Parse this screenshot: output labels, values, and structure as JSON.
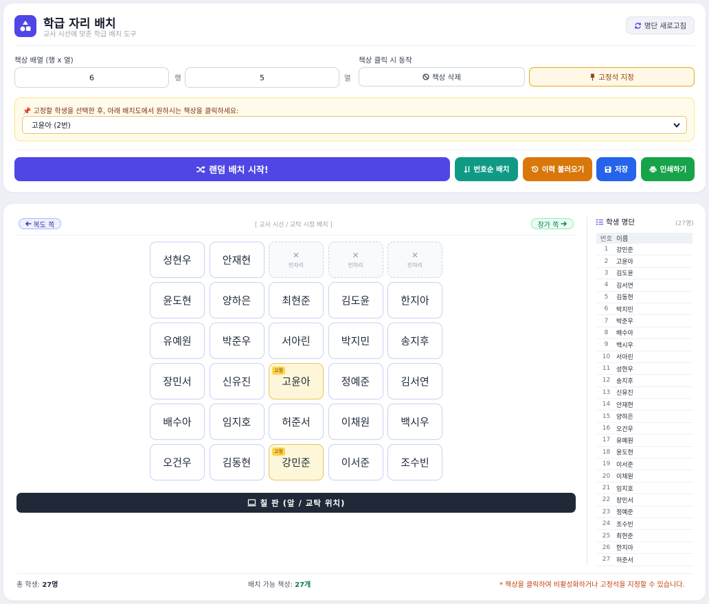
{
  "header": {
    "title": "학급 자리 배치",
    "subtitle": "교사 시선에 맞춘 학급 배치 도구",
    "refresh_label": "명단 새로고침"
  },
  "layout_controls": {
    "label": "책상 배열 (행 x 열)",
    "rows": "6",
    "rows_unit": "행",
    "cols": "5",
    "cols_unit": "열"
  },
  "click_mode": {
    "label": "책상 클릭 시 동작",
    "delete_label": "책상 삭제",
    "fixed_label": "고정석 지정"
  },
  "fixed_panel": {
    "hint": "고정할 학생을 선택한 후, 아래 배치도에서 원하시는 책상을 클릭하세요:",
    "selected": "고윤아 (2번)"
  },
  "actions": {
    "random": "랜덤 배치 시작!",
    "by_number": "번호순 배치",
    "history": "이력 불러오기",
    "save": "저장",
    "print": "인쇄하기"
  },
  "seating": {
    "north_label": "복도 쪽",
    "window_label": "창가 쪽",
    "view_caption": "[ 교사 시선 / 교탁 시점 배치 ]",
    "empty_label": "빈자리",
    "fixed_badge": "고정",
    "blackboard": "칠 판 (앞 / 교탁 위치)",
    "grid": [
      [
        {
          "name": "성현우"
        },
        {
          "name": "안재현"
        },
        {
          "empty": true
        },
        {
          "empty": true
        },
        {
          "empty": true
        }
      ],
      [
        {
          "name": "윤도현"
        },
        {
          "name": "양하은"
        },
        {
          "name": "최현준"
        },
        {
          "name": "김도윤"
        },
        {
          "name": "한지아"
        }
      ],
      [
        {
          "name": "유예원"
        },
        {
          "name": "박준우"
        },
        {
          "name": "서아린"
        },
        {
          "name": "박지민"
        },
        {
          "name": "송지후"
        }
      ],
      [
        {
          "name": "장민서"
        },
        {
          "name": "신유진"
        },
        {
          "name": "고윤아",
          "fixed": true
        },
        {
          "name": "정예준"
        },
        {
          "name": "김서연"
        }
      ],
      [
        {
          "name": "배수아"
        },
        {
          "name": "임지호"
        },
        {
          "name": "허준서"
        },
        {
          "name": "이채원"
        },
        {
          "name": "백시우"
        }
      ],
      [
        {
          "name": "오건우"
        },
        {
          "name": "김동현"
        },
        {
          "name": "강민준",
          "fixed": true
        },
        {
          "name": "이서준"
        },
        {
          "name": "조수빈"
        }
      ]
    ]
  },
  "footer": {
    "total_label": "총 학생: ",
    "total_value": "27명",
    "available_label": "배치 가능 책상: ",
    "available_value": "27개",
    "note": "* 책상을 클릭하여 비활성화하거나 고정석을 지정할 수 있습니다."
  },
  "roster": {
    "title": "학생 명단",
    "count": "(27명)",
    "col_no": "번호",
    "col_name": "이름",
    "students": [
      {
        "no": "1",
        "name": "강민준"
      },
      {
        "no": "2",
        "name": "고윤아"
      },
      {
        "no": "3",
        "name": "김도윤"
      },
      {
        "no": "4",
        "name": "김서연"
      },
      {
        "no": "5",
        "name": "김동현"
      },
      {
        "no": "6",
        "name": "박지민"
      },
      {
        "no": "7",
        "name": "박준우"
      },
      {
        "no": "8",
        "name": "배수아"
      },
      {
        "no": "9",
        "name": "백시우"
      },
      {
        "no": "10",
        "name": "서아린"
      },
      {
        "no": "11",
        "name": "성현우"
      },
      {
        "no": "12",
        "name": "송지후"
      },
      {
        "no": "13",
        "name": "신유진"
      },
      {
        "no": "14",
        "name": "안재현"
      },
      {
        "no": "15",
        "name": "양하은"
      },
      {
        "no": "16",
        "name": "오건우"
      },
      {
        "no": "17",
        "name": "유예원"
      },
      {
        "no": "18",
        "name": "윤도현"
      },
      {
        "no": "19",
        "name": "이서준"
      },
      {
        "no": "20",
        "name": "이채원"
      },
      {
        "no": "21",
        "name": "임지호"
      },
      {
        "no": "22",
        "name": "장민서"
      },
      {
        "no": "23",
        "name": "정예준"
      },
      {
        "no": "24",
        "name": "조수빈"
      },
      {
        "no": "25",
        "name": "최현준"
      },
      {
        "no": "26",
        "name": "한지아"
      },
      {
        "no": "27",
        "name": "허준서"
      }
    ]
  },
  "colors": {
    "primary": "#4f46e5",
    "teal": "#0f9a86",
    "orange": "#d9770b",
    "blue": "#2563eb",
    "green": "#16a34a",
    "fixed_bg": "#fef6d8",
    "blackboard": "#1f2937"
  }
}
